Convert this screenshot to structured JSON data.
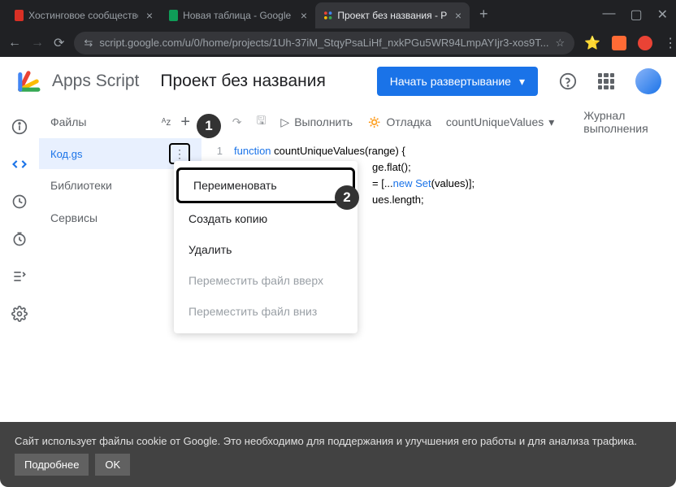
{
  "browser": {
    "tabs": [
      {
        "title": "Хостинговое сообщество «Tim",
        "favicon": "#d93025"
      },
      {
        "title": "Новая таблица - Google Табли",
        "favicon": "#0f9d58"
      },
      {
        "title": "Проект без названия - Редакт",
        "favicon": "multi"
      }
    ],
    "active_tab": 2,
    "url": "script.google.com/u/0/home/projects/1Uh-37iM_StqyPsaLiHf_nxkPGu5WR94LmpAYIjr3-xos9T..."
  },
  "header": {
    "app_name": "Apps Script",
    "project_name": "Проект без названия",
    "deploy_button": "Начать развертывание"
  },
  "files": {
    "header": "Файлы",
    "items": [
      {
        "name": "Код.gs",
        "selected": true
      }
    ],
    "sections": [
      "Библиотеки",
      "Сервисы"
    ]
  },
  "toolbar": {
    "run": "Выполнить",
    "debug": "Отладка",
    "function_select": "countUniqueValues",
    "log": "Журнал выполнения"
  },
  "code": {
    "lines": [
      {
        "n": "1",
        "parts": [
          {
            "t": "function ",
            "c": "kw"
          },
          {
            "t": "countUniqueValues",
            "c": "fn"
          },
          {
            "t": "(range) {",
            "c": ""
          }
        ]
      },
      {
        "n": "",
        "parts": [
          {
            "t": "ge.flat();",
            "c": ""
          }
        ]
      },
      {
        "n": "",
        "parts": [
          {
            "t": " = [...",
            "c": ""
          },
          {
            "t": "new ",
            "c": "str-new"
          },
          {
            "t": "Set",
            "c": "kw"
          },
          {
            "t": "(values)];",
            "c": ""
          }
        ]
      },
      {
        "n": "",
        "parts": [
          {
            "t": "ues.length;",
            "c": ""
          }
        ]
      }
    ]
  },
  "context_menu": {
    "items": [
      {
        "label": "Переименовать",
        "highlighted": true
      },
      {
        "label": "Создать копию"
      },
      {
        "label": "Удалить"
      },
      {
        "label": "Переместить файл вверх",
        "disabled": true
      },
      {
        "label": "Переместить файл вниз",
        "disabled": true
      }
    ]
  },
  "annotations": {
    "badge1": "1",
    "badge2": "2"
  },
  "cookie": {
    "text": "Сайт использует файлы cookie от Google. Это необходимо для поддержания и улучшения его работы и для анализа трафика.",
    "more": "Подробнее",
    "ok": "OK"
  }
}
